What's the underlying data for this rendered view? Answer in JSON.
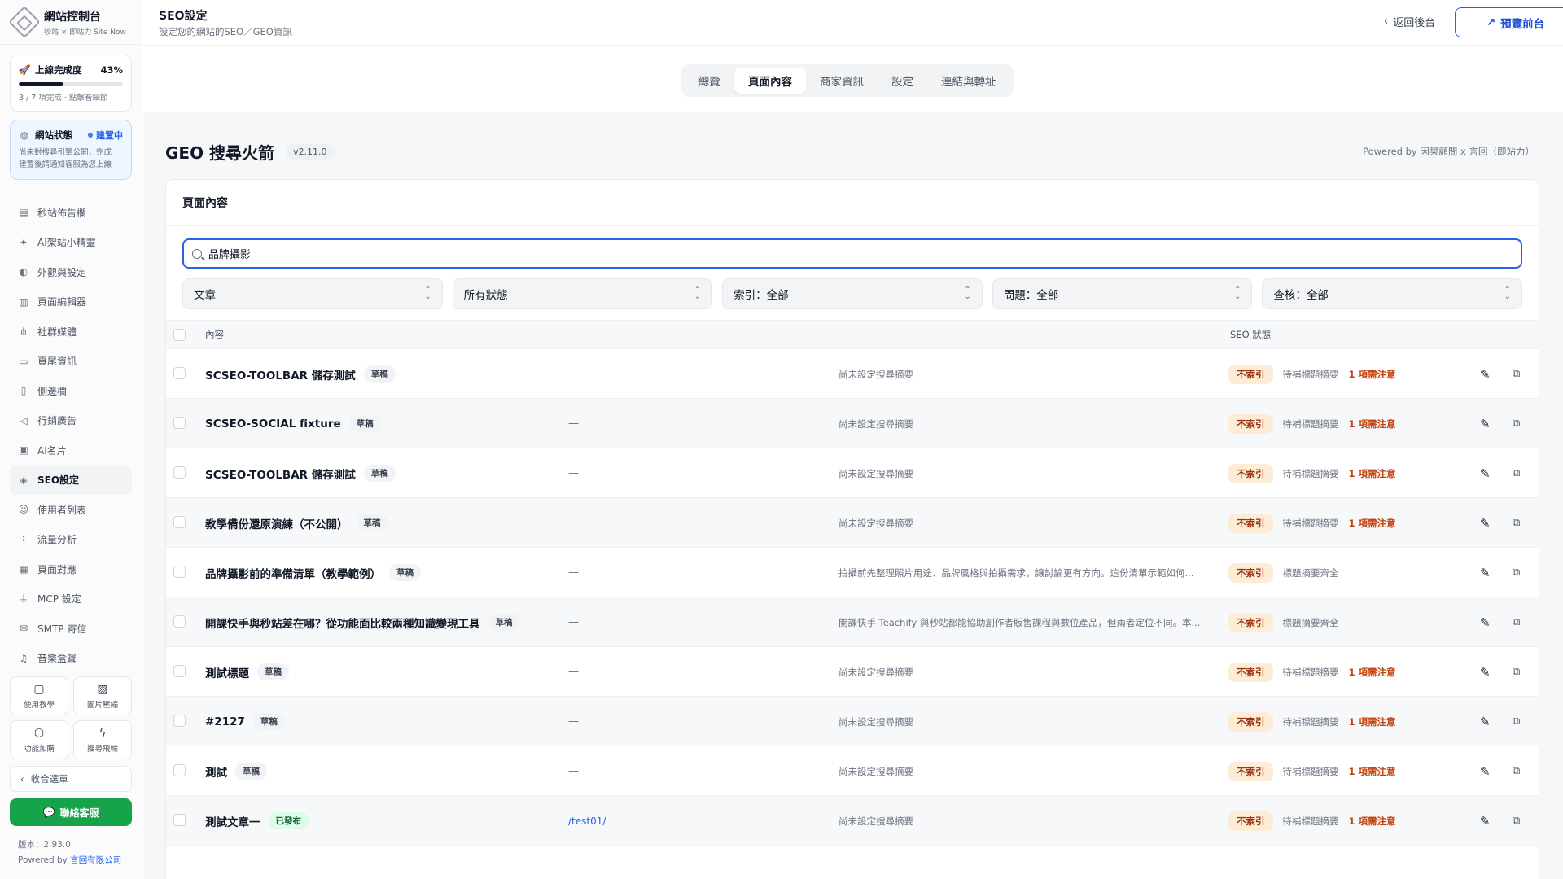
{
  "brand": {
    "title": "網站控制台",
    "subtitle": "秒站 × 即站力 Site Now"
  },
  "progress_card": {
    "title": "上線完成度",
    "percent_label": "43%",
    "percent": 43,
    "detail": "3 / 7 項完成 · 點擊看細節"
  },
  "status_card": {
    "title": "網站狀態",
    "badge": "建置中",
    "desc_line1": "尚未對搜尋引擎公開，完成",
    "desc_line2": "建置後請通知客服為您上線"
  },
  "nav": [
    {
      "label": "秒站佈告欄",
      "icon": "bulletin-icon"
    },
    {
      "label": "AI架站小精靈",
      "icon": "sparkle-icon"
    },
    {
      "label": "外觀與設定",
      "icon": "palette-icon"
    },
    {
      "label": "頁面編輯器",
      "icon": "layout-icon"
    },
    {
      "label": "社群媒體",
      "icon": "share-icon"
    },
    {
      "label": "頁尾資訊",
      "icon": "footer-icon"
    },
    {
      "label": "側邊欄",
      "icon": "sidebar-icon"
    },
    {
      "label": "行銷廣告",
      "icon": "megaphone-icon"
    },
    {
      "label": "AI名片",
      "icon": "card-icon"
    },
    {
      "label": "SEO設定",
      "icon": "seo-icon",
      "active": true
    },
    {
      "label": "使用者列表",
      "icon": "users-icon"
    },
    {
      "label": "流量分析",
      "icon": "chart-icon"
    },
    {
      "label": "頁面對應",
      "icon": "map-icon"
    },
    {
      "label": "MCP 設定",
      "icon": "plug-icon"
    },
    {
      "label": "SMTP 寄信",
      "icon": "mail-icon"
    },
    {
      "label": "音樂盒聲",
      "icon": "music-icon"
    }
  ],
  "quick": [
    {
      "label": "使用教學",
      "icon": "book-icon"
    },
    {
      "label": "圖片壓縮",
      "icon": "image-icon"
    },
    {
      "label": "功能加購",
      "icon": "package-icon"
    },
    {
      "label": "搜尋飛輪",
      "icon": "bolt-icon"
    }
  ],
  "collapse_label": "收合選單",
  "contact_label": "聯絡客服",
  "version_label": "版本：2.93.0",
  "powered_prefix": "Powered by ",
  "powered_company": "言回有限公司",
  "header": {
    "title": "SEO設定",
    "subtitle": "設定您的網站的SEO／GEO資訊",
    "back_label": "返回後台",
    "preview_label": "預覽前台"
  },
  "tabs": [
    {
      "label": "總覽"
    },
    {
      "label": "頁面內容",
      "active": true
    },
    {
      "label": "商家資訊"
    },
    {
      "label": "設定"
    },
    {
      "label": "連結與轉址"
    }
  ],
  "main": {
    "title": "GEO 搜尋火箭",
    "version": "v2.11.0",
    "powered": "Powered by 因果顧問 x 言回（即站力）"
  },
  "panel": {
    "title": "頁面內容",
    "search_value": "品牌攝影",
    "filters": [
      "文章",
      "所有狀態",
      "索引：全部",
      "問題：全部",
      "查核：全部"
    ],
    "columns": {
      "content": "內容",
      "seo": "SEO 狀態"
    }
  },
  "rows": [
    {
      "title": "SCSEO-TOOLBAR 儲存測試",
      "tag": "草稿",
      "slug": "—",
      "desc": "尚未設定搜尋摘要",
      "index": "不索引",
      "state": "待補標題摘要",
      "warn": "1 項需注意"
    },
    {
      "title": "SCSEO-SOCIAL fixture",
      "tag": "草稿",
      "slug": "—",
      "desc": "尚未設定搜尋摘要",
      "index": "不索引",
      "state": "待補標題摘要",
      "warn": "1 項需注意"
    },
    {
      "title": "SCSEO-TOOLBAR 儲存測試",
      "tag": "草稿",
      "slug": "—",
      "desc": "尚未設定搜尋摘要",
      "index": "不索引",
      "state": "待補標題摘要",
      "warn": "1 項需注意"
    },
    {
      "title": "教學備份還原演練（不公開）",
      "tag": "草稿",
      "slug": "—",
      "desc": "尚未設定搜尋摘要",
      "index": "不索引",
      "state": "待補標題摘要",
      "warn": "1 項需注意"
    },
    {
      "title": "品牌攝影前的準備清單（教學範例）",
      "tag": "草稿",
      "slug": "—",
      "desc": "拍攝前先整理照片用途、品牌風格與拍攝需求，讓討論更有方向。這份清單示範如何...",
      "index": "不索引",
      "state": "標題摘要齊全",
      "warn": ""
    },
    {
      "title": "開課快手與秒站差在哪？從功能面比較兩種知識變現工具",
      "tag": "草稿",
      "slug": "—",
      "desc": "開課快手 Teachify 與秒站都能協助創作者販售課程與數位產品，但兩者定位不同。本...",
      "index": "不索引",
      "state": "標題摘要齊全",
      "warn": ""
    },
    {
      "title": "測試標題",
      "tag": "草稿",
      "slug": "—",
      "desc": "尚未設定搜尋摘要",
      "index": "不索引",
      "state": "待補標題摘要",
      "warn": "1 項需注意"
    },
    {
      "title": "#2127",
      "tag": "草稿",
      "slug": "—",
      "desc": "尚未設定搜尋摘要",
      "index": "不索引",
      "state": "待補標題摘要",
      "warn": "1 項需注意"
    },
    {
      "title": "測試",
      "tag": "草稿",
      "slug": "—",
      "desc": "尚未設定搜尋摘要",
      "index": "不索引",
      "state": "待補標題摘要",
      "warn": "1 項需注意"
    },
    {
      "title": "測試文章一",
      "tag": "已發布",
      "published": true,
      "slug": "/test01/",
      "desc": "尚未設定搜尋摘要",
      "index": "不索引",
      "state": "待補標題摘要",
      "warn": "1 項需注意"
    }
  ]
}
